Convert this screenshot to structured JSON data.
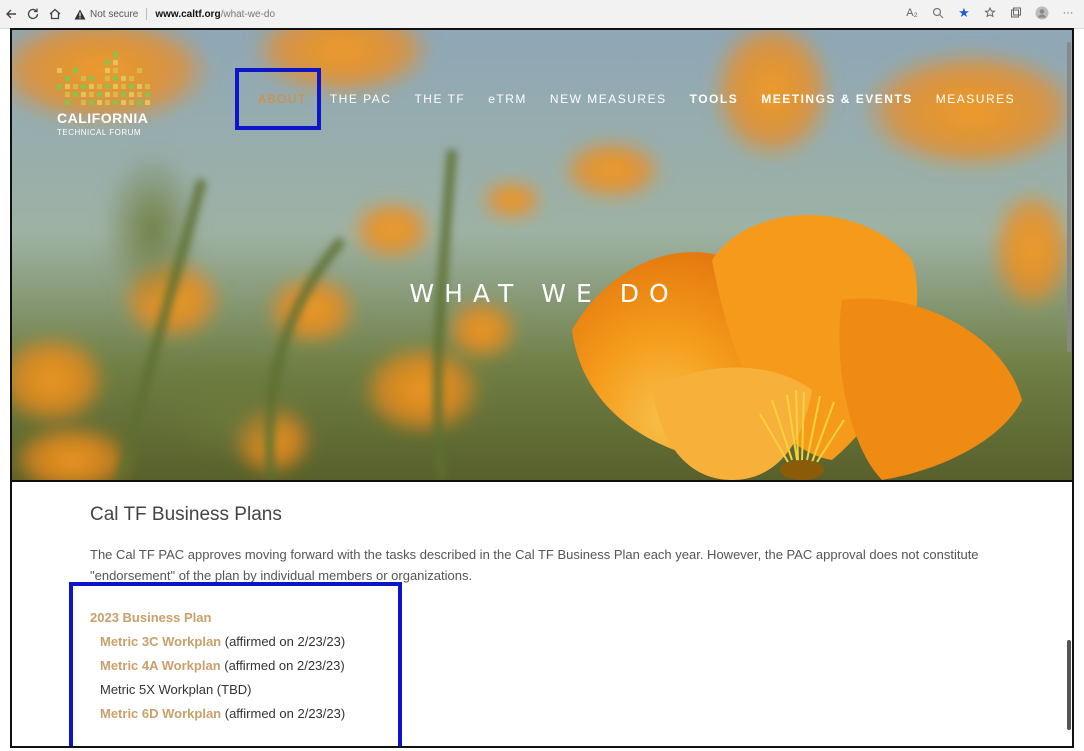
{
  "browser": {
    "not_secure_label": "Not secure",
    "url_host": "www.caltf.org",
    "url_path": "/what-we-do"
  },
  "logo": {
    "title": "CALIFORNIA",
    "subtitle": "TECHNICAL FORUM",
    "dot_colors": [
      "#d9b84a",
      "#8bc34a",
      "#e6c35a"
    ]
  },
  "nav": {
    "items": [
      {
        "label": "ABOUT",
        "active": true
      },
      {
        "label": "THE PAC"
      },
      {
        "label": "THE TF"
      },
      {
        "label": "eTRM"
      },
      {
        "label": "NEW MEASURES"
      },
      {
        "label": "TOOLS",
        "bold": true
      },
      {
        "label": "MEETINGS & EVENTS",
        "bold": true
      },
      {
        "label": "MEASURES"
      }
    ]
  },
  "hero": {
    "title": "WHAT WE DO"
  },
  "content": {
    "section_title": "Cal TF Business Plans",
    "intro": "The Cal TF PAC approves moving forward with the tasks described in the Cal TF Business Plan each year. However, the PAC approval does not constitute \"endorsement\" of the plan by individual members or organizations.",
    "plan_heading": "2023 Business Plan",
    "plans": [
      {
        "link": "Metric 3C Workplan",
        "note": " (affirmed on 2/23/23)"
      },
      {
        "link": "Metric 4A Workplan",
        "note": " (affirmed on 2/23/23)"
      },
      {
        "text": "Metric 5X Workplan (TBD)"
      },
      {
        "link": "Metric 6D Workplan",
        "note": " (affirmed on 2/23/23)"
      }
    ]
  },
  "colors": {
    "accent_orange": "#e58a25",
    "link_gold": "#c9a06b",
    "highlight_blue": "#0c15c8"
  }
}
